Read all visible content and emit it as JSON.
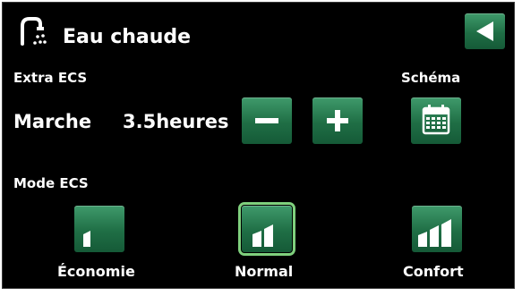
{
  "header": {
    "title": "Eau chaude",
    "icon": "tap-hot-water-icon",
    "back_icon": "back-arrow-icon"
  },
  "extra_ecs": {
    "label": "Extra ECS",
    "state": "Marche",
    "duration": "3.5heures",
    "minus_icon": "minus-icon",
    "plus_icon": "plus-icon"
  },
  "schedule": {
    "label": "Schéma",
    "icon": "calendar-icon"
  },
  "mode_ecs": {
    "label": "Mode ECS",
    "options": [
      {
        "label": "Économie",
        "icon": "level-low-icon",
        "selected": false
      },
      {
        "label": "Normal",
        "icon": "level-medium-icon",
        "selected": true
      },
      {
        "label": "Confort",
        "icon": "level-high-icon",
        "selected": false
      }
    ]
  },
  "colors": {
    "background": "#000000",
    "button_green": "#2a7f53",
    "selected_outline": "#7fd07d",
    "text": "#ffffff"
  }
}
